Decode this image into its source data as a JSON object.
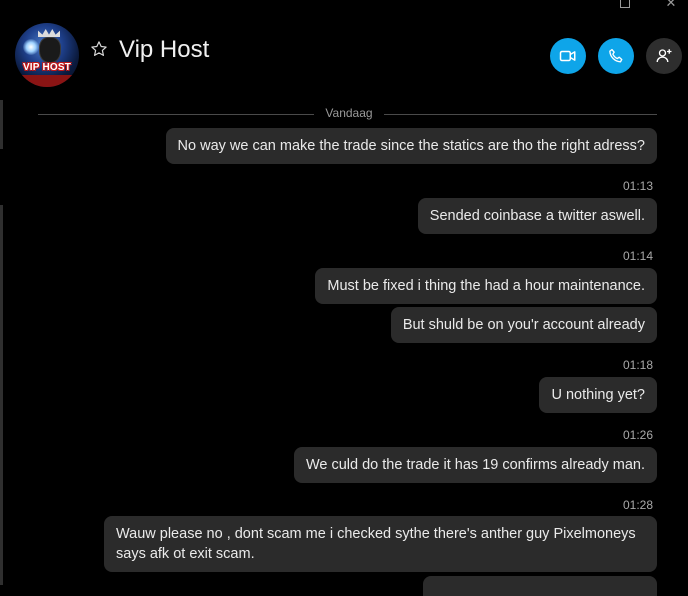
{
  "window": {
    "maximize_label": "☐",
    "close_label": "✕"
  },
  "header": {
    "avatar_text": "VIP HOST",
    "contact_name": "Vip Host",
    "favorite_icon": "star-outline-icon",
    "video_call_icon": "video-camera-icon",
    "audio_call_icon": "phone-icon",
    "add_people_icon": "add-person-icon",
    "accent_color": "#0ea5e9"
  },
  "chat": {
    "date_divider": "Vandaag",
    "messages": [
      {
        "text": "No way we can make the trade since the statics are tho the right adress?"
      },
      {
        "time": "01:13"
      },
      {
        "text": "Sended coinbase a twitter aswell."
      },
      {
        "time": "01:14"
      },
      {
        "text": "Must be fixed i thing the had a hour maintenance."
      },
      {
        "text": "But shuld be on you'r account already"
      },
      {
        "time": "01:18"
      },
      {
        "text": "U nothing yet?"
      },
      {
        "time": "01:26"
      },
      {
        "text": "We culd do the trade it has 19 confirms already man."
      },
      {
        "time": "01:28"
      },
      {
        "text": "Wauw please no , dont scam me i checked sythe there's anther guy Pixelmoneys says afk ot exit scam."
      }
    ]
  }
}
